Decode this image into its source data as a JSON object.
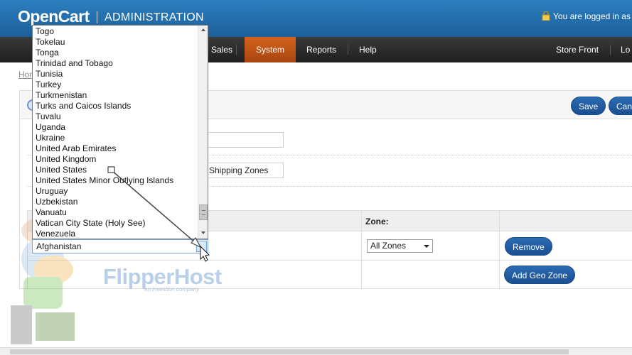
{
  "header": {
    "brand": "OpenCart",
    "subtitle": "ADMINISTRATION",
    "login_text": "You are logged in as"
  },
  "menu": {
    "items": [
      "Sales",
      "System",
      "Reports",
      "Help"
    ],
    "active": "System",
    "right": [
      "Store Front",
      "Lo"
    ]
  },
  "breadcrumb": "Hom",
  "toolbar": {
    "save_label": "Save",
    "cancel_label": "Can"
  },
  "form": {
    "name_value": "",
    "description_value": "Shipping Zones"
  },
  "table": {
    "headers": [
      "",
      "Zone:",
      ""
    ],
    "country_value": "Afghanistan",
    "zone_value": "All Zones",
    "remove_label": "Remove",
    "add_label": "Add Geo Zone"
  },
  "dropdown": {
    "options": [
      "Togo",
      "Tokelau",
      "Tonga",
      "Trinidad and Tobago",
      "Tunisia",
      "Turkey",
      "Turkmenistan",
      "Turks and Caicos Islands",
      "Tuvalu",
      "Uganda",
      "Ukraine",
      "United Arab Emirates",
      "United Kingdom",
      "United States",
      "United States Minor Outlying Islands",
      "Uruguay",
      "Uzbekistan",
      "Vanuatu",
      "Vatican City State (Holy See)",
      "Venezuela"
    ]
  },
  "watermark": {
    "brand": "FlipperHost",
    "tagline": "an investion company"
  },
  "colors": {
    "header": "#1e6aa8",
    "menu": "#2a2a2a",
    "active_menu": "#c8591a",
    "button": "#2160a8"
  }
}
